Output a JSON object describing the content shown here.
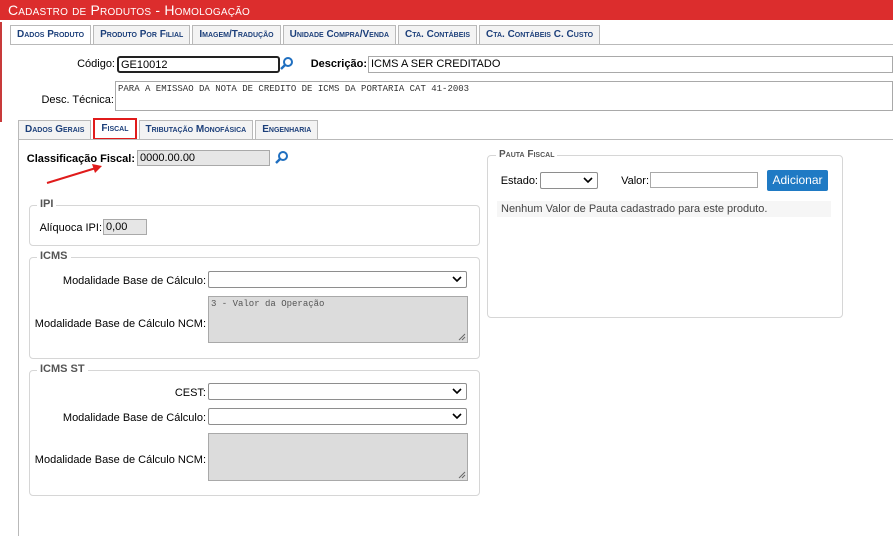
{
  "title": "Cadastro de Produtos  - Homologação",
  "top_tabs": [
    "Dados Produto",
    "Produto Por Filial",
    "Imagem/Tradução",
    "Unidade Compra/Venda",
    "Cta. Contábeis",
    "Cta. Contábeis C. Custo"
  ],
  "header": {
    "codigo_label": "Código:",
    "codigo_value": "GE10012",
    "descricao_label": "Descrição:",
    "descricao_value": "ICMS A SER CREDITADO",
    "desc_tecnica_label": "Desc. Técnica:",
    "desc_tecnica_value": "PARA A EMISSAO DA NOTA DE CREDITO DE ICMS DA PORTARIA CAT 41-2003"
  },
  "sub_tabs": [
    "Dados Gerais",
    "Fiscal",
    "Tributação Monofásica",
    "Engenharia"
  ],
  "fiscal": {
    "classificacao_label": "Classificação Fiscal:",
    "classificacao_value": "0000.00.00",
    "ipi": {
      "legend": "IPI",
      "aliquota_label": "Alíquoca IPI:",
      "aliquota_value": "0,00"
    },
    "icms": {
      "legend": "ICMS",
      "modalidade_label": "Modalidade Base de Cálculo:",
      "modalidade_value": "",
      "modalidade_ncm_label": "Modalidade Base de Cálculo NCM:",
      "modalidade_ncm_value": "3 - Valor da Operação"
    },
    "icms_st": {
      "legend": "ICMS ST",
      "cest_label": "CEST:",
      "cest_value": "",
      "modalidade_label": "Modalidade Base de Cálculo:",
      "modalidade_value": "",
      "modalidade_ncm_label": "Modalidade Base de Cálculo NCM:",
      "modalidade_ncm_value": ""
    },
    "pauta": {
      "legend": "Pauta Fiscal",
      "estado_label": "Estado:",
      "estado_value": "",
      "valor_label": "Valor:",
      "valor_value": "",
      "add_button": "Adicionar",
      "empty_message": "Nenhum Valor de Pauta cadastrado para este produto."
    }
  },
  "colors": {
    "title_bar": "#dc2d2d",
    "tab_text": "#1c3f7a",
    "button": "#1f7ac4",
    "highlight": "#e01b1b"
  }
}
